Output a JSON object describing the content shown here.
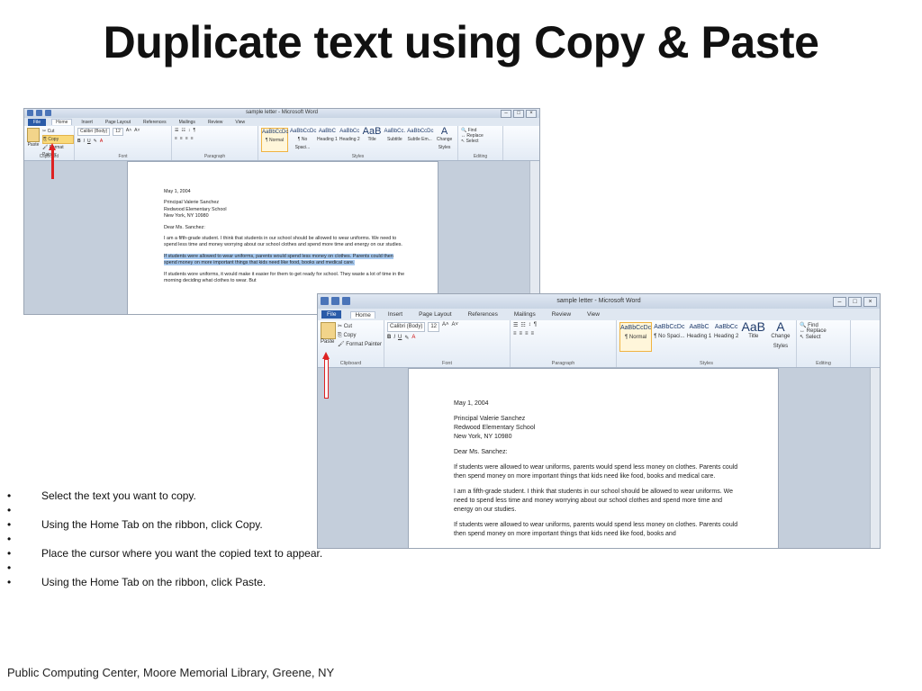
{
  "slide": {
    "title": "Duplicate text using Copy & Paste",
    "bullets": [
      "Select the text you want to copy.",
      "",
      "Using the Home Tab on the ribbon, click Copy.",
      "",
      "Place the cursor where you want the copied text to appear.",
      "",
      "Using the Home Tab on the ribbon, click Paste."
    ],
    "bullet_symbol": "•",
    "footer": "Public Computing Center,  Moore Memorial Library, Greene, NY"
  },
  "word": {
    "window_title": "sample letter - Microsoft Word",
    "tabs": [
      "File",
      "Home",
      "Insert",
      "Page Layout",
      "References",
      "Mailings",
      "Review",
      "View"
    ],
    "clipboard": {
      "paste": "Paste",
      "cut": "Cut",
      "copy": "Copy",
      "format_painter": "Format Painter",
      "label": "Clipboard"
    },
    "font": {
      "name": "Calibri (Body)",
      "size": "12",
      "label": "Font"
    },
    "paragraph": {
      "label": "Paragraph"
    },
    "styles": {
      "label": "Styles",
      "tiles": [
        {
          "sample": "AaBbCcDc",
          "name": "¶ Normal"
        },
        {
          "sample": "AaBbCcDc",
          "name": "¶ No Spaci..."
        },
        {
          "sample": "AaBbC",
          "name": "Heading 1"
        },
        {
          "sample": "AaBbCc",
          "name": "Heading 2"
        },
        {
          "sample": "AaB",
          "name": "Title"
        },
        {
          "sample": "AaBbCc.",
          "name": "Subtitle"
        },
        {
          "sample": "AaBbCcDc",
          "name": "Subtle Em..."
        }
      ],
      "change": "Change Styles"
    },
    "editing": {
      "find": "Find",
      "replace": "Replace",
      "select": "Select",
      "label": "Editing"
    }
  },
  "doc1": {
    "date": "May 1, 2004",
    "address": [
      "Principal Valerie Sanchez",
      "Redwood Elementary School",
      "New York, NY 10980"
    ],
    "greeting": "Dear Ms. Sanchez:",
    "para1": "I am a fifth-grade student.   I think that students in our school should be allowed to wear uniforms. We need to spend less time and money worrying about our school clothes and spend more time and energy on our studies.",
    "para_selected": "If students  were allowed to wear uniforms, parents would spend less money on clothes. Parents could then spend money on more important things that kids need like food, books and medical care.",
    "para3": "If students  wore uniforms, it would make it easier for them to get ready for school. They waste a lot of time in the morning deciding what clothes to wear.  But"
  },
  "doc2": {
    "date": "May 1, 2004",
    "address": [
      "Principal Valerie Sanchez",
      "Redwood Elementary School",
      "New York, NY 10980"
    ],
    "greeting": "Dear Ms. Sanchez:",
    "para_pasted": "If students  were allowed to wear uniforms, parents would spend less money on clothes. Parents could then spend money on more important things that kids need like food, books and medical care.",
    "para1": "I am a fifth-grade student.   I think that students in our school should be allowed to wear uniforms. We need to spend less time and money worrying about our school clothes and spend more time and energy on our studies.",
    "para3": "If students  were allowed to wear uniforms, parents would spend less money on clothes. Parents could then spend money on more important things that kids need like food, books and"
  }
}
